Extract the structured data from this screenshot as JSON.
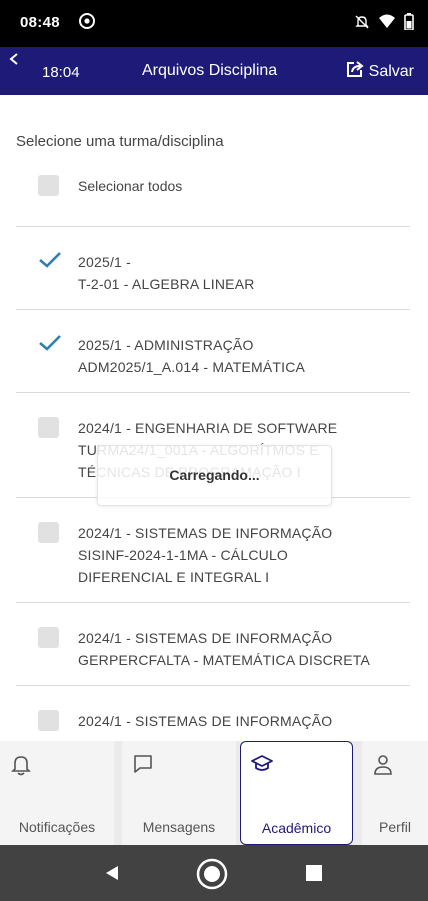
{
  "status_bar": {
    "time": "08:48",
    "icons": [
      "at-sign-icon",
      "mute-icon",
      "wifi-icon",
      "battery-icon"
    ]
  },
  "header": {
    "clock": "18:04",
    "title": "Arquivos Disciplina",
    "save_label": "Salvar",
    "background": "#1e1a78"
  },
  "content": {
    "section_title": "Selecione uma turma/disciplina",
    "select_all_label": "Selecionar todos",
    "items": [
      {
        "line1": "2025/1 -",
        "line2": "T-2-01 - ALGEBRA LINEAR",
        "checked": true
      },
      {
        "line1": "2025/1 - ADMINISTRAÇÃO",
        "line2": "ADM2025/1_A.014 - MATEMÁTICA",
        "checked": true
      },
      {
        "line1": "2024/1 - ENGENHARIA DE SOFTWARE",
        "line2": "TURMA24/1_001A - ALGORÍTMOS E",
        "line3": "TÉCNICAS DE PROGRAMAÇÃO I",
        "checked": false
      },
      {
        "line1": "2024/1 - SISTEMAS DE INFORMAÇÃO",
        "line2": "SISINF-2024-1-1MA - CÁLCULO",
        "line3": "DIFERENCIAL E INTEGRAL I",
        "checked": false
      },
      {
        "line1": "2024/1 - SISTEMAS DE INFORMAÇÃO",
        "line2": "GERPERCFALTA - MATEMÁTICA DISCRETA",
        "checked": false
      },
      {
        "line1": "2024/1 - SISTEMAS DE INFORMAÇÃO",
        "checked": false
      }
    ],
    "loading_text": "Carregando..."
  },
  "tabs": [
    {
      "label": "Notificações",
      "icon": "bell-icon",
      "active": false
    },
    {
      "label": "Mensagens",
      "icon": "chat-icon",
      "active": false
    },
    {
      "label": "Acadêmico",
      "icon": "graduation-cap-icon",
      "active": true
    },
    {
      "label": "Perfil",
      "icon": "person-icon",
      "active": false
    }
  ],
  "nav": [
    "back-icon",
    "home-icon",
    "recents-icon"
  ]
}
